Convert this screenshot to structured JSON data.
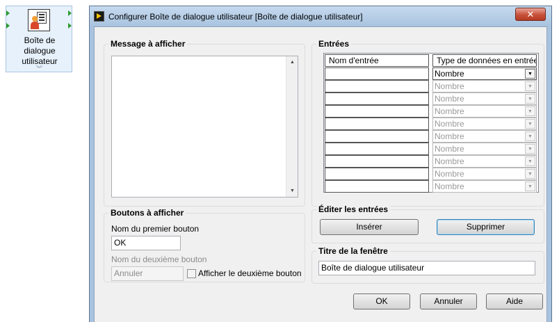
{
  "node": {
    "label_lines": [
      "Boîte de",
      "dialogue",
      "utilisateur"
    ]
  },
  "window": {
    "title": "Configurer Boîte de dialogue utilisateur [Boîte de dialogue utilisateur]",
    "close_glyph": "✕"
  },
  "message": {
    "group_title": "Message à afficher",
    "text": ""
  },
  "buttons_group": {
    "title": "Boutons à afficher",
    "first_label": "Nom du premier bouton",
    "first_value": "OK",
    "second_label": "Nom du deuxième bouton",
    "second_value": "Annuler",
    "show_second_label": "Afficher le deuxième bouton",
    "show_second_checked": false
  },
  "inputs": {
    "group_title": "Entrées",
    "col_name": "Nom d'entrée",
    "col_type": "Type de données en entrée",
    "rows": [
      {
        "name": "",
        "type": "Nombre"
      },
      {
        "name": "",
        "type": "Nombre"
      },
      {
        "name": "",
        "type": "Nombre"
      },
      {
        "name": "",
        "type": "Nombre"
      },
      {
        "name": "",
        "type": "Nombre"
      },
      {
        "name": "",
        "type": "Nombre"
      },
      {
        "name": "",
        "type": "Nombre"
      },
      {
        "name": "",
        "type": "Nombre"
      },
      {
        "name": "",
        "type": "Nombre"
      },
      {
        "name": "",
        "type": "Nombre"
      }
    ]
  },
  "edit_inputs": {
    "title": "Éditer les entrées",
    "insert": "Insérer",
    "delete": "Supprimer"
  },
  "window_title_group": {
    "title": "Titre de la fenêtre",
    "value": "Boîte de dialogue utilisateur"
  },
  "footer": {
    "ok": "OK",
    "cancel": "Annuler",
    "help": "Aide"
  }
}
